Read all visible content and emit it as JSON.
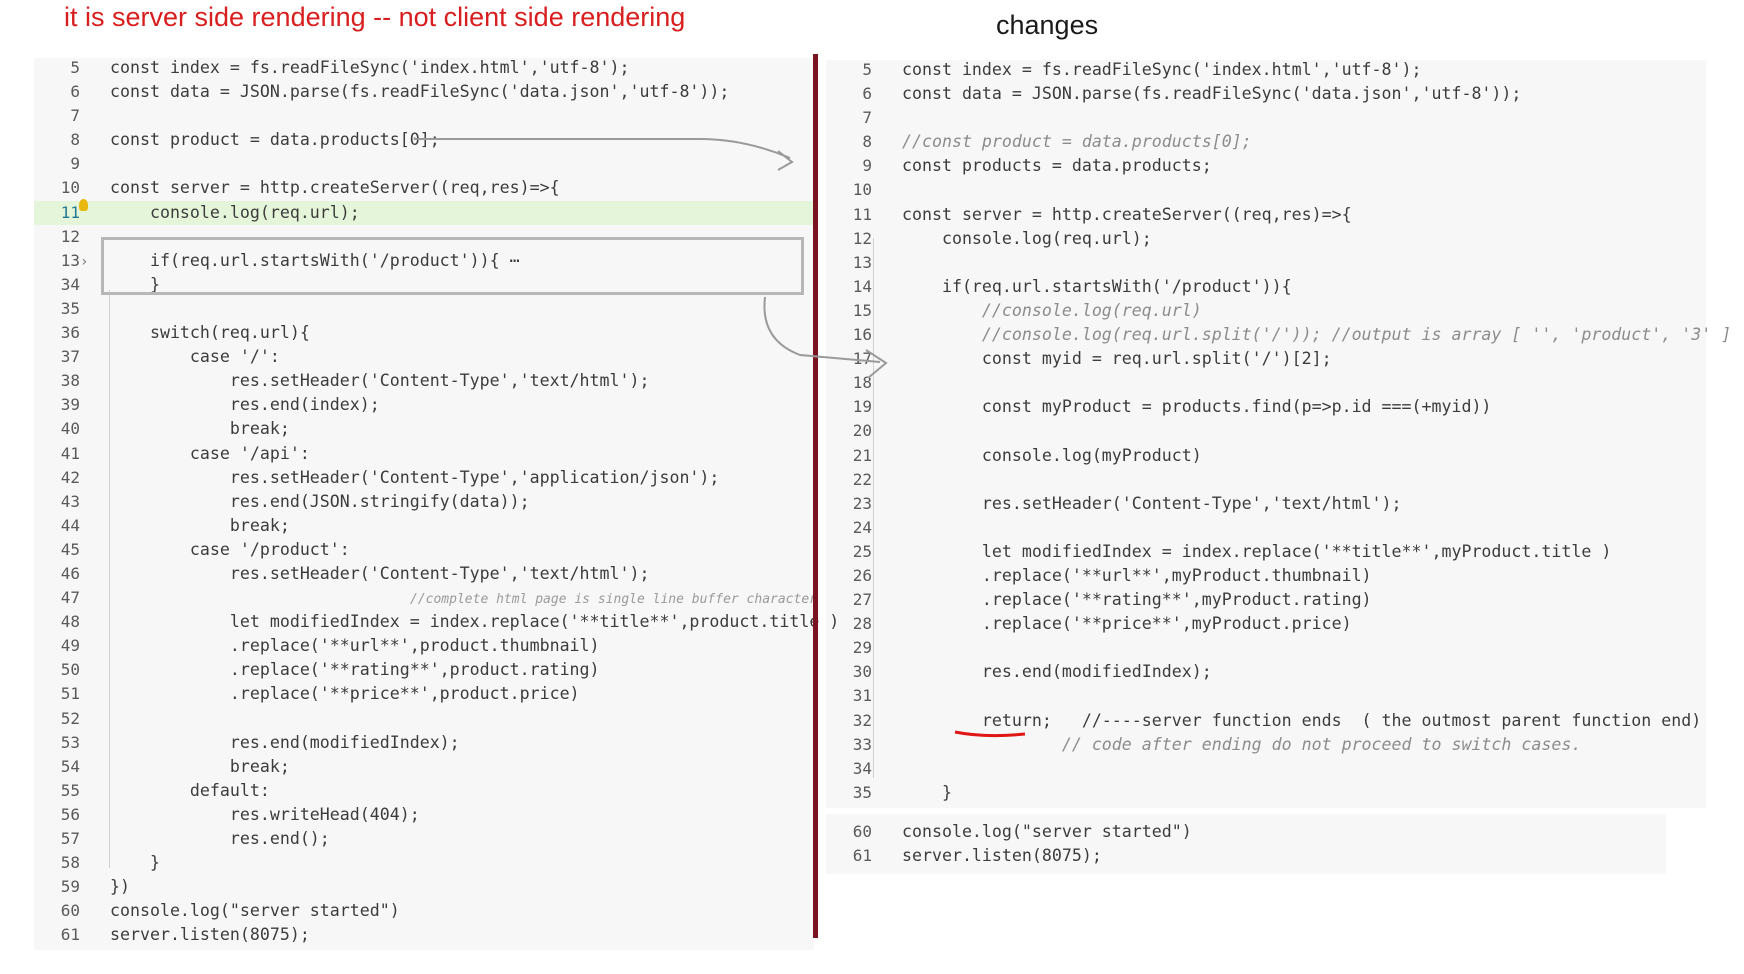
{
  "headings": {
    "left": "it is server side rendering  -- not client side rendering",
    "right": "changes"
  },
  "left_code": [
    {
      "ln": "5",
      "text": "const index = fs.readFileSync('index.html','utf-8');"
    },
    {
      "ln": "6",
      "text": "const data = JSON.parse(fs.readFileSync('data.json','utf-8'));"
    },
    {
      "ln": "7",
      "text": ""
    },
    {
      "ln": "8",
      "text": "const product = data.products[0];"
    },
    {
      "ln": "9",
      "text": ""
    },
    {
      "ln": "10",
      "text": "const server = http.createServer((req,res)=>{"
    },
    {
      "ln": "11",
      "text": "    console.log(req.url);"
    },
    {
      "ln": "12",
      "text": ""
    },
    {
      "ln": "13",
      "text": "    if(req.url.startsWith('/product')){ ⋯"
    },
    {
      "ln": "34",
      "text": "    }"
    },
    {
      "ln": "35",
      "text": ""
    },
    {
      "ln": "36",
      "text": "    switch(req.url){"
    },
    {
      "ln": "37",
      "text": "        case '/':"
    },
    {
      "ln": "38",
      "text": "            res.setHeader('Content-Type','text/html');"
    },
    {
      "ln": "39",
      "text": "            res.end(index);"
    },
    {
      "ln": "40",
      "text": "            break;"
    },
    {
      "ln": "41",
      "text": "        case '/api':"
    },
    {
      "ln": "42",
      "text": "            res.setHeader('Content-Type','application/json');"
    },
    {
      "ln": "43",
      "text": "            res.end(JSON.stringify(data));"
    },
    {
      "ln": "44",
      "text": "            break;"
    },
    {
      "ln": "45",
      "text": "        case '/product':"
    },
    {
      "ln": "46",
      "text": "            res.setHeader('Content-Type','text/html');"
    },
    {
      "ln": "47",
      "text": "//complete html page is single line buffer character"
    },
    {
      "ln": "48",
      "text": "            let modifiedIndex = index.replace('**title**',product.title )"
    },
    {
      "ln": "49",
      "text": "            .replace('**url**',product.thumbnail)"
    },
    {
      "ln": "50",
      "text": "            .replace('**rating**',product.rating)"
    },
    {
      "ln": "51",
      "text": "            .replace('**price**',product.price)"
    },
    {
      "ln": "52",
      "text": ""
    },
    {
      "ln": "53",
      "text": "            res.end(modifiedIndex);"
    },
    {
      "ln": "54",
      "text": "            break;"
    },
    {
      "ln": "55",
      "text": "        default:"
    },
    {
      "ln": "56",
      "text": "            res.writeHead(404);"
    },
    {
      "ln": "57",
      "text": "            res.end();"
    },
    {
      "ln": "58",
      "text": "    }"
    },
    {
      "ln": "59",
      "text": "})"
    },
    {
      "ln": "60",
      "text": "console.log(\"server started\")"
    },
    {
      "ln": "61",
      "text": "server.listen(8075);"
    }
  ],
  "right_code": [
    {
      "ln": "5",
      "text": "const index = fs.readFileSync('index.html','utf-8');"
    },
    {
      "ln": "6",
      "text": "const data = JSON.parse(fs.readFileSync('data.json','utf-8'));"
    },
    {
      "ln": "7",
      "text": ""
    },
    {
      "ln": "8",
      "text": "//const product = data.products[0];"
    },
    {
      "ln": "9",
      "text": "const products = data.products;"
    },
    {
      "ln": "10",
      "text": ""
    },
    {
      "ln": "11",
      "text": "const server = http.createServer((req,res)=>{"
    },
    {
      "ln": "12",
      "text": "    console.log(req.url);"
    },
    {
      "ln": "13",
      "text": ""
    },
    {
      "ln": "14",
      "text": "    if(req.url.startsWith('/product')){"
    },
    {
      "ln": "15",
      "text": "        //console.log(req.url)"
    },
    {
      "ln": "16",
      "text": "        //console.log(req.url.split('/')); //output is array [ '', 'product', '3' ]"
    },
    {
      "ln": "17",
      "text": "        const myid = req.url.split('/')[2];"
    },
    {
      "ln": "18",
      "text": ""
    },
    {
      "ln": "19",
      "text": "        const myProduct = products.find(p=>p.id ===(+myid))"
    },
    {
      "ln": "20",
      "text": ""
    },
    {
      "ln": "21",
      "text": "        console.log(myProduct)"
    },
    {
      "ln": "22",
      "text": ""
    },
    {
      "ln": "23",
      "text": "        res.setHeader('Content-Type','text/html');"
    },
    {
      "ln": "24",
      "text": ""
    },
    {
      "ln": "25",
      "text": "        let modifiedIndex = index.replace('**title**',myProduct.title )"
    },
    {
      "ln": "26",
      "text": "        .replace('**url**',myProduct.thumbnail)"
    },
    {
      "ln": "27",
      "text": "        .replace('**rating**',myProduct.rating)"
    },
    {
      "ln": "28",
      "text": "        .replace('**price**',myProduct.price)"
    },
    {
      "ln": "29",
      "text": ""
    },
    {
      "ln": "30",
      "text": "        res.end(modifiedIndex);"
    },
    {
      "ln": "31",
      "text": ""
    },
    {
      "ln": "32",
      "text": "        return;   //----server function ends  ( the outmost parent function end)"
    },
    {
      "ln": "33",
      "text": "                // code after ending do not proceed to switch cases."
    },
    {
      "ln": "34",
      "text": ""
    },
    {
      "ln": "35",
      "text": "    }"
    }
  ],
  "right_footer_code": [
    {
      "ln": "60",
      "text": "console.log(\"server started\")"
    },
    {
      "ln": "61",
      "text": "server.listen(8075);"
    }
  ]
}
